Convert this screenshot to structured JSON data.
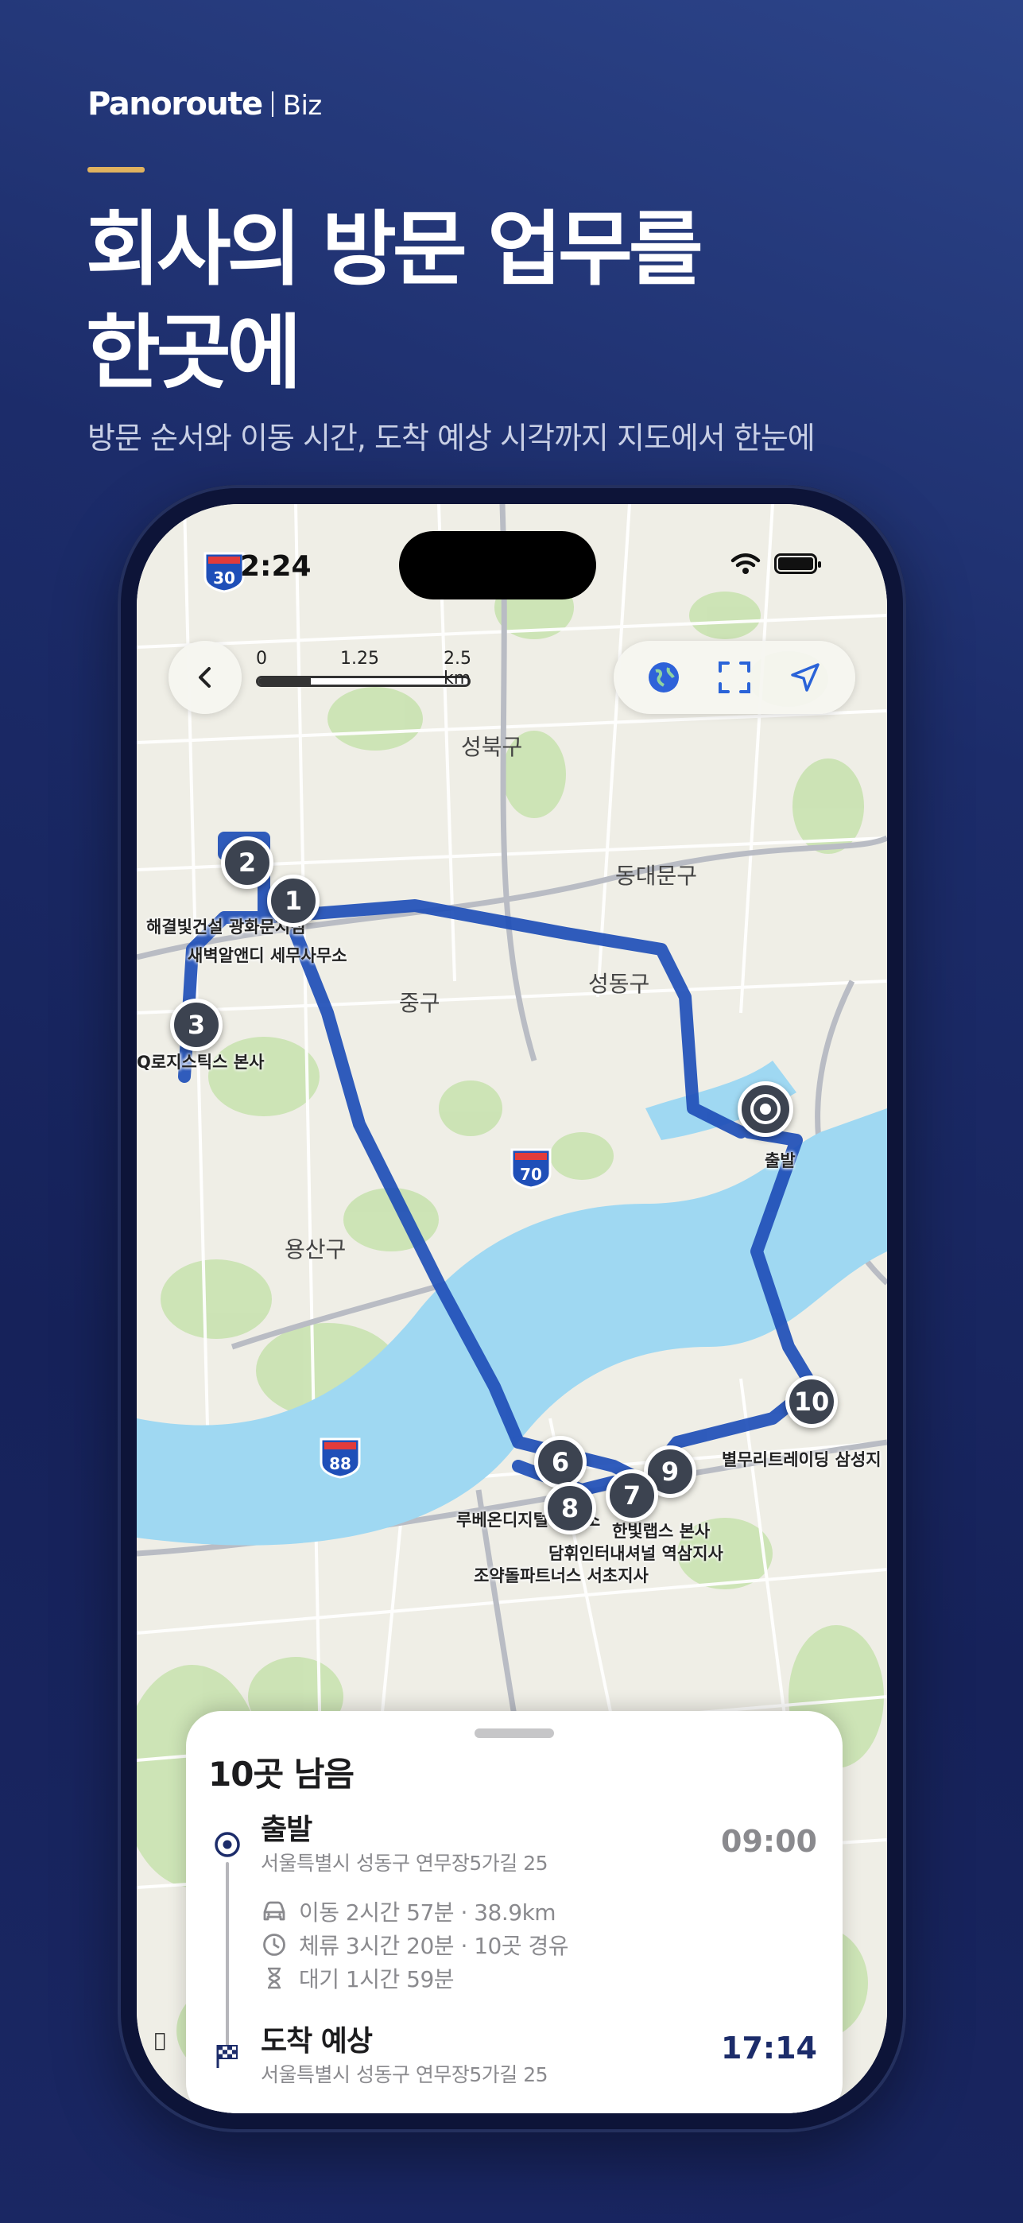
{
  "brand": {
    "name": "Panoroute",
    "sub": "Biz"
  },
  "headline": {
    "line1": "회사의 방문 업무를",
    "line2": "한곳에"
  },
  "subheadline": "방문 순서와 이동 시간, 도착 예상 시각까지 지도에서 한눈에",
  "status_bar": {
    "time": "2:24"
  },
  "scale": {
    "labels": [
      "0",
      "1.25",
      "2.5 km"
    ]
  },
  "map": {
    "districts": [
      "성북구",
      "동대문구",
      "중구",
      "성동구",
      "용산구"
    ],
    "highways": [
      "30",
      "70",
      "88"
    ],
    "start_label": "출발",
    "stops": [
      {
        "number": "1",
        "label": ""
      },
      {
        "number": "2",
        "label": ""
      },
      {
        "number": "3",
        "label": "Q로지스틱스 본사"
      },
      {
        "number": "6",
        "label": ""
      },
      {
        "number": "7",
        "label": ""
      },
      {
        "number": "8",
        "label": ""
      },
      {
        "number": "9",
        "label": ""
      },
      {
        "number": "10",
        "label": "별무리트레이딩 삼성지"
      }
    ],
    "labels": {
      "cluster_a": "해결빛건설 광화문지점",
      "cluster_b": "새벽알앤디 세무사무소",
      "stop6_label": "루베온디지털 사무소",
      "stop7_label": "한빛랩스 본사",
      "stop8_label": "담휘인터내셔널 역삼지사",
      "stop8b_label": "조약돌파트너스 서초지사"
    }
  },
  "sheet": {
    "remaining": "10곳 남음",
    "start": {
      "title": "출발",
      "address": "서울특별시 성동구 연무장5가길 25",
      "time": "09:00"
    },
    "stats": [
      {
        "icon": "car-icon",
        "text": "이동 2시간 57분 · 38.9km"
      },
      {
        "icon": "clock-icon",
        "text": "체류 3시간 20분 · 10곳 경유"
      },
      {
        "icon": "hourglass-icon",
        "text": "대기 1시간 59분"
      }
    ],
    "arrival": {
      "title": "도착 예상",
      "address": "서울특별시 성동구 연무장5가길 25",
      "time": "17:14"
    }
  },
  "colors": {
    "accent": "#e0b25f",
    "route": "#1f4fb8",
    "river": "#9fd8f2",
    "arrival_time": "#1c2c6a"
  }
}
